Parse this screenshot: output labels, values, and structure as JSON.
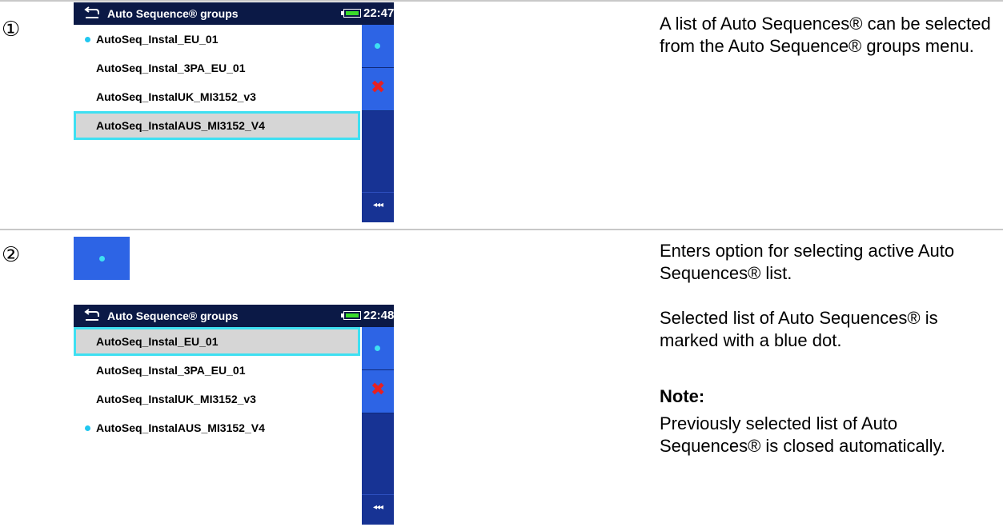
{
  "steps": [
    {
      "number": "①",
      "screen": {
        "title": "Auto Sequence® groups",
        "time": "22:47",
        "battery_level": 0.9,
        "items": [
          {
            "label": "AutoSeq_Instal_EU_01",
            "active_dot": true,
            "selected": false
          },
          {
            "label": "AutoSeq_Instal_3PA_EU_01",
            "active_dot": false,
            "selected": false
          },
          {
            "label": "AutoSeq_InstalUK_MI3152_v3",
            "active_dot": false,
            "selected": false
          },
          {
            "label": "AutoSeq_InstalAUS_MI3152_V4",
            "active_dot": false,
            "selected": true
          }
        ],
        "sidebar": {
          "select_icon": "dot-icon",
          "delete_icon": "red-x-icon",
          "back_label": "◂◂◂"
        }
      },
      "description": "A list of Auto Sequences® can be selected from the Auto Sequence® groups menu."
    },
    {
      "number": "②",
      "button_icon": "dot-icon",
      "screen": {
        "title": "Auto Sequence® groups",
        "time": "22:48",
        "battery_level": 0.9,
        "items": [
          {
            "label": "AutoSeq_Instal_EU_01",
            "active_dot": false,
            "selected": true
          },
          {
            "label": "AutoSeq_Instal_3PA_EU_01",
            "active_dot": false,
            "selected": false
          },
          {
            "label": "AutoSeq_InstalUK_MI3152_v3",
            "active_dot": false,
            "selected": false
          },
          {
            "label": "AutoSeq_InstalAUS_MI3152_V4",
            "active_dot": true,
            "selected": false
          }
        ],
        "sidebar": {
          "select_icon": "dot-icon",
          "delete_icon": "red-x-icon",
          "back_label": "◂◂◂"
        }
      },
      "description_1": "Enters option for selecting active Auto Sequences® list.",
      "description_2": "Selected list of Auto Sequences® is marked with a blue dot.",
      "note_heading": "Note:",
      "note_text": "Previously selected list of Auto Sequences® is closed automatically."
    }
  ],
  "colors": {
    "titlebar": "#0b1946",
    "sidebar": "#173394",
    "button": "#2d64e5",
    "dot": "#21c7f0",
    "selection_border": "#3ee0f2",
    "selection_fill": "#d6d6d6",
    "delete_x": "#e82020"
  }
}
